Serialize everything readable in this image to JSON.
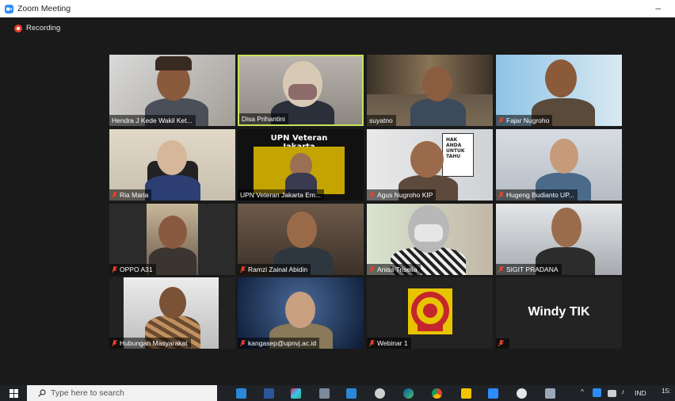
{
  "window": {
    "title": "Zoom Meeting",
    "minimize_label": "–"
  },
  "recording": {
    "label": "Recording"
  },
  "participants": [
    {
      "name": "Hendra J Kede Wakil Ket..."
    },
    {
      "name": "Disa Prihantini"
    },
    {
      "name": "suyatno"
    },
    {
      "name": "Fajar Nugroho"
    },
    {
      "name": "Ria Maria"
    },
    {
      "name": "UPN Veteran Jakarta Em..."
    },
    {
      "name": "Agus Nugroho KIP"
    },
    {
      "name": "Hugeng Budianto UP..."
    },
    {
      "name": "OPPO A31"
    },
    {
      "name": "Ramzi Zainal Abidin"
    },
    {
      "name": "Anisa Triselia"
    },
    {
      "name": "SIGIT PRADANA"
    },
    {
      "name": "Hubungan Masyarakat"
    },
    {
      "name": "kangasep@upnvj.ac.id"
    },
    {
      "name": "Webinar 1"
    },
    {
      "name": ""
    }
  ],
  "tiles": {
    "upn_banner": "UPN Veteran Jakarta",
    "windy_label": "Windy TIK",
    "agus_sign": "HAK ANDA UNTUK TAHU"
  },
  "taskbar": {
    "search_placeholder": "Type here to search",
    "language": "IND",
    "time": "15:"
  }
}
